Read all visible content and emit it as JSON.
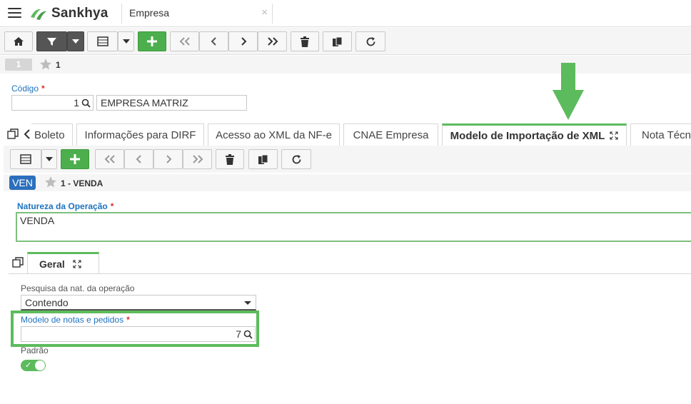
{
  "app": {
    "brand": "Sankhya",
    "window_tab": "Empresa",
    "close_glyph": "×"
  },
  "record_bar": {
    "count": "1",
    "record_label": "1"
  },
  "form": {
    "codigo_label": "Código",
    "codigo_value": "1",
    "empresa_name": "EMPRESA MATRIZ",
    "required_mark": "*"
  },
  "tabs": [
    {
      "label": "Boleto"
    },
    {
      "label": "Informações para DIRF"
    },
    {
      "label": "Acesso ao XML da NF-e"
    },
    {
      "label": "CNAE Empresa"
    },
    {
      "label": "Modelo de Importação de XML",
      "active": true
    },
    {
      "label": "Nota Técnica"
    }
  ],
  "detail": {
    "badge": "VEN",
    "record_label": "1 - VENDA",
    "natureza_label": "Natureza da Operação",
    "natureza_value": "VENDA",
    "inner_tab": "Geral",
    "pesquisa_label": "Pesquisa da nat. da operação",
    "pesquisa_value": "Contendo",
    "modelo_label": "Modelo de notas e pedidos",
    "modelo_value": "7",
    "padrao_label": "Padrão",
    "padrao_on": true,
    "toggle_check": "✓"
  },
  "colors": {
    "accent_green": "#5cbb5c",
    "link_blue": "#1e73be",
    "badge_blue": "#2c6fbd",
    "required_red": "#d9302c"
  }
}
